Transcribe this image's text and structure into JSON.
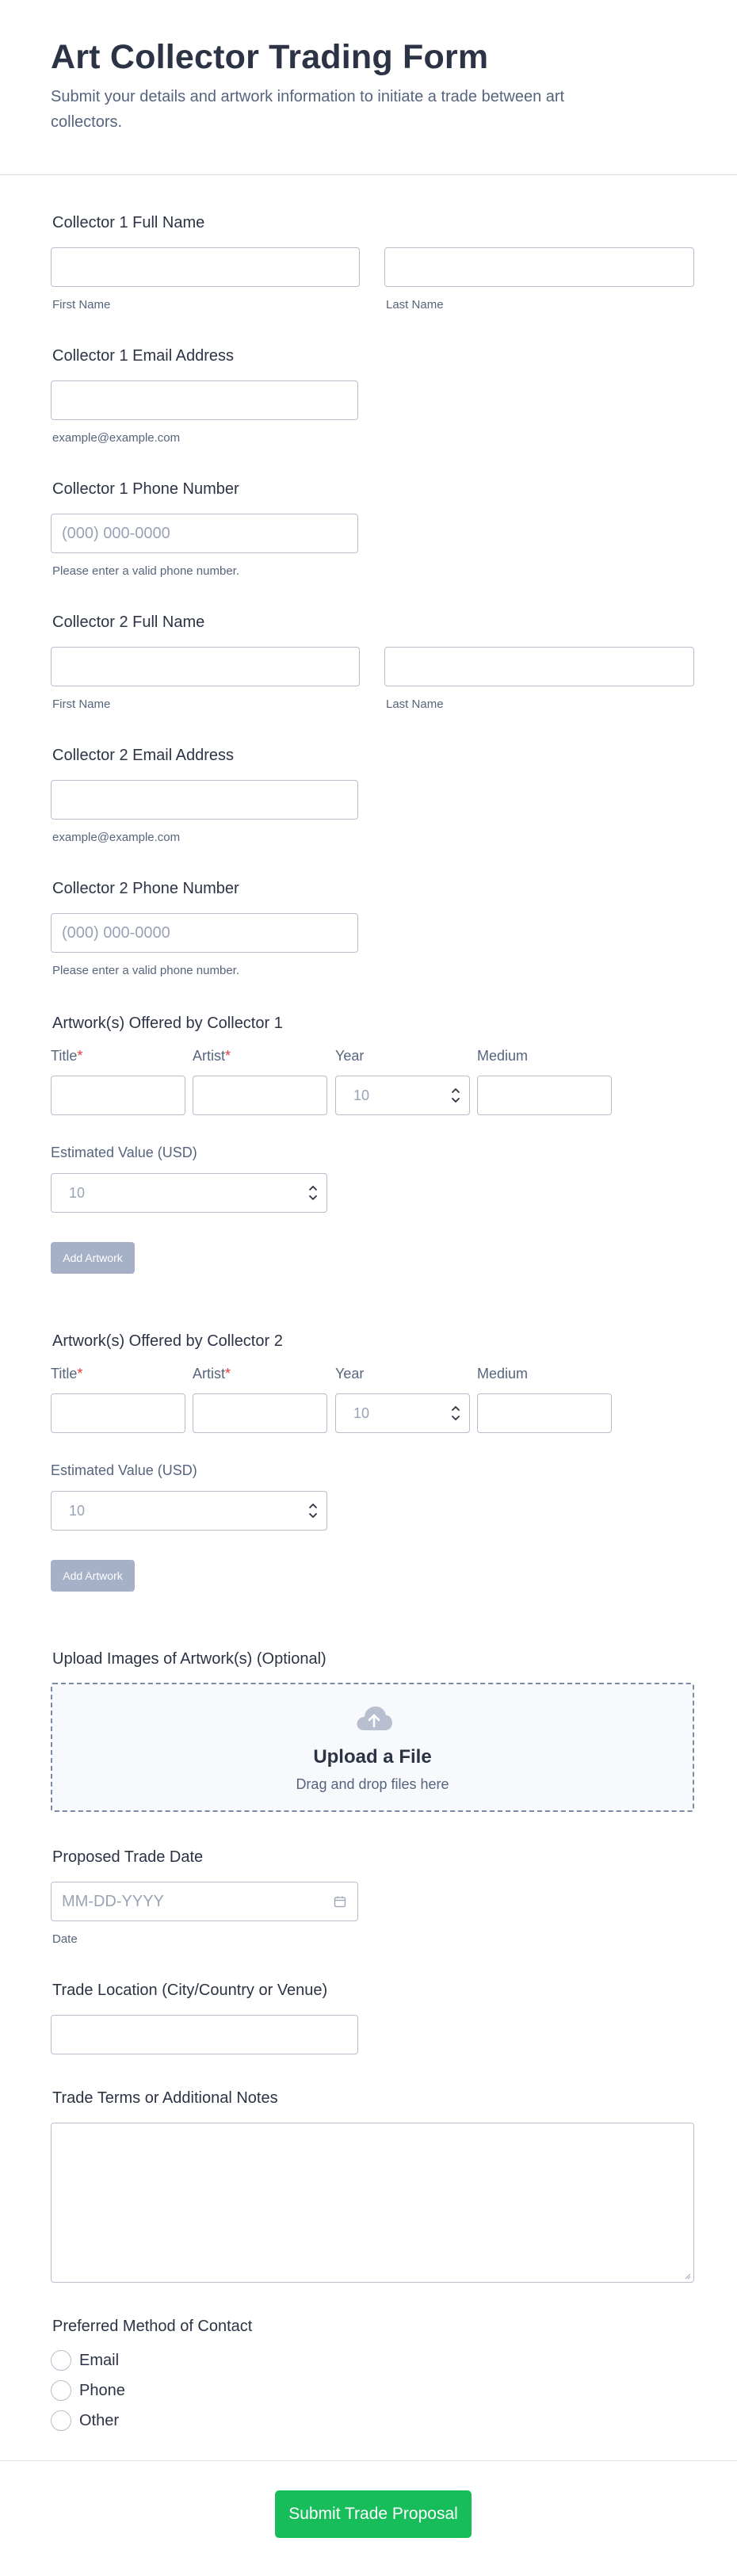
{
  "header": {
    "title": "Art Collector Trading Form",
    "subtitle": "Submit your details and artwork information to initiate a trade between art collectors."
  },
  "collector1": {
    "name_label": "Collector 1 Full Name",
    "first_sub": "First Name",
    "last_sub": "Last Name",
    "email_label": "Collector 1 Email Address",
    "email_sub": "example@example.com",
    "phone_label": "Collector 1 Phone Number",
    "phone_placeholder": "(000) 000-0000",
    "phone_sub": "Please enter a valid phone number."
  },
  "collector2": {
    "name_label": "Collector 2 Full Name",
    "first_sub": "First Name",
    "last_sub": "Last Name",
    "email_label": "Collector 2 Email Address",
    "email_sub": "example@example.com",
    "phone_label": "Collector 2 Phone Number",
    "phone_placeholder": "(000) 000-0000",
    "phone_sub": "Please enter a valid phone number."
  },
  "artworks1": {
    "label": "Artwork(s) Offered by Collector 1",
    "columns": {
      "title": "Title",
      "artist": "Artist",
      "year": "Year",
      "medium": "Medium"
    },
    "required_mark": "*",
    "year_placeholder": "10",
    "value_label": "Estimated Value (USD)",
    "value_placeholder": "10",
    "add_button": "Add Artwork"
  },
  "artworks2": {
    "label": "Artwork(s) Offered by Collector 2",
    "columns": {
      "title": "Title",
      "artist": "Artist",
      "year": "Year",
      "medium": "Medium"
    },
    "required_mark": "*",
    "year_placeholder": "10",
    "value_label": "Estimated Value (USD)",
    "value_placeholder": "10",
    "add_button": "Add Artwork"
  },
  "upload": {
    "label": "Upload Images of Artwork(s) (Optional)",
    "title": "Upload a File",
    "subtitle": "Drag and drop files here",
    "icon": "cloud-upload-icon"
  },
  "trade_date": {
    "label": "Proposed Trade Date",
    "placeholder": "MM-DD-YYYY",
    "sub": "Date",
    "icon": "calendar-icon"
  },
  "location": {
    "label": "Trade Location (City/Country or Venue)"
  },
  "notes": {
    "label": "Trade Terms or Additional Notes"
  },
  "contact": {
    "label": "Preferred Method of Contact",
    "options": [
      "Email",
      "Phone",
      "Other"
    ]
  },
  "submit": {
    "label": "Submit Trade Proposal"
  },
  "colors": {
    "accent": "#18bd5b",
    "required": "#e23b3b",
    "disabled_button": "#a6b0c6",
    "text": "#2c3345"
  }
}
